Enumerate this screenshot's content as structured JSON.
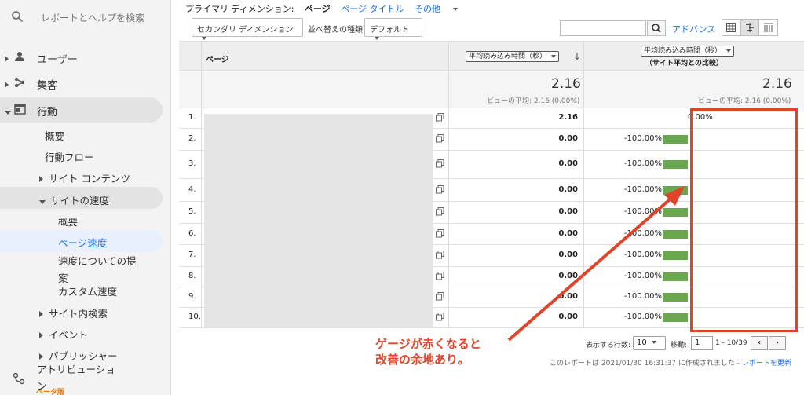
{
  "sidebar": {
    "search_text": "レポートとヘルプを検索",
    "items": [
      {
        "label": "ユーザー"
      },
      {
        "label": "集客"
      },
      {
        "label": "行動"
      }
    ],
    "behavior_sub": [
      "概要",
      "行動フロー",
      "サイト コンテンツ",
      "サイトの速度"
    ],
    "speed_sub": [
      "概要",
      "ページ速度",
      "速度についての提",
      "案",
      "カスタム速度"
    ],
    "more": [
      "サイト内検索",
      "イベント",
      "パブリッシャー"
    ],
    "attribution": "アトリビューショ",
    "attribution_2": "ン",
    "beta": "ベータ版"
  },
  "dimension_bar": {
    "primary_label": "プライマリ ディメンション:",
    "primary_value": "ページ",
    "page_title_link": "ページ タイトル",
    "other_link": "その他"
  },
  "toolbar": {
    "secondary_dimension": "セカンダリ ディメンション",
    "sort_label": "並べ替えの種類:",
    "sort_value": "デフォルト",
    "advanced": "アドバンス"
  },
  "table": {
    "col_page": "ページ",
    "metric_select": "平均読み込み時間（秒）",
    "compare_select": "平均読み込み時間（秒）",
    "compare_sub": "（サイト平均との比較）",
    "total_value": "2.16",
    "total_avg": "ビューの平均: 2.16 (0.00%)",
    "compare_total": "2.16",
    "compare_avg": "ビューの平均: 2.16 (0.00%)",
    "rows": [
      {
        "n": "1.",
        "v": "2.16",
        "p": "0.00%"
      },
      {
        "n": "2.",
        "v": "0.00",
        "p": "-100.00%"
      },
      {
        "n": "3.",
        "v": "0.00",
        "p": "-100.00%"
      },
      {
        "n": "4.",
        "v": "0.00",
        "p": "-100.00%"
      },
      {
        "n": "5.",
        "v": "0.00",
        "p": "-100.00%"
      },
      {
        "n": "6.",
        "v": "0.00",
        "p": "-100.00%"
      },
      {
        "n": "7.",
        "v": "0.00",
        "p": "-100.00%"
      },
      {
        "n": "8.",
        "v": "0.00",
        "p": "-100.00%"
      },
      {
        "n": "9.",
        "v": "0.00",
        "p": "-100.00%"
      },
      {
        "n": "10.",
        "v": "0.00",
        "p": "-100.00%"
      }
    ]
  },
  "footer": {
    "rows_label": "表示する行数:",
    "rows_value": "10",
    "goto_label": "移動:",
    "goto_value": "1",
    "range": "1 - 10/39",
    "created_prefix": "このレポートは 2021/01/30 16:31:37 に作成されました -",
    "refresh": "レポートを更新"
  },
  "annotation": {
    "line1": "ゲージが赤くなると",
    "line2": "改善の余地あり。",
    "color": "#e0442a"
  }
}
